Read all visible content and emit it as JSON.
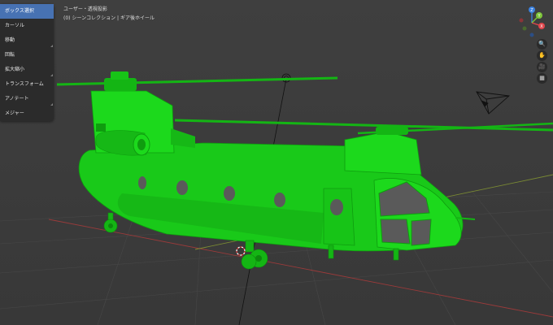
{
  "toolbar": {
    "items": [
      {
        "label": "ボックス選択",
        "active": true
      },
      {
        "label": "カーソル",
        "active": false
      },
      {
        "label": "移動",
        "active": false
      },
      {
        "label": "回転",
        "active": false
      },
      {
        "label": "拡大縮小",
        "active": false
      },
      {
        "label": "トランスフォーム",
        "active": false
      },
      {
        "label": "アノテート",
        "active": false
      },
      {
        "label": "メジャー",
        "active": false
      }
    ]
  },
  "viewport": {
    "view_label": "ユーザー・透視投影",
    "collection_label": "(0) シーンコレクション | ギア後ホイール"
  },
  "gizmo": {
    "x_label": "X",
    "y_label": "Y",
    "z_label": "Z",
    "x_color": "#e0464c",
    "y_color": "#7ec63a",
    "z_color": "#3b82e0"
  },
  "nav_icons": [
    "zoom-icon",
    "pan-hand-icon",
    "camera-view-icon",
    "ortho-grid-icon"
  ],
  "colors": {
    "model": "#1cd91c",
    "grid_x_axis": "#9a3a3a",
    "grid_y_axis": "#7a8a33",
    "background": "#3d3d3d",
    "active_tool": "#4772b3"
  }
}
